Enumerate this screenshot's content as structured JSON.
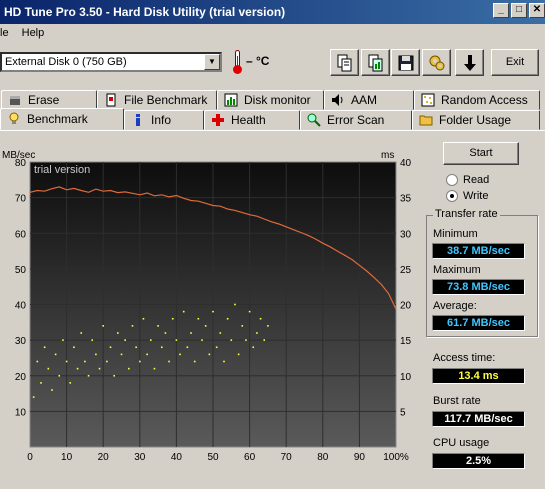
{
  "window": {
    "title": "HD Tune Pro 3.50 - Hard Disk Utility (trial version)"
  },
  "menu": {
    "file": "le",
    "help": "Help"
  },
  "toolbar": {
    "disk": "External Disk 0 (750 GB)",
    "temperature": "– °C",
    "exit_label": "Exit"
  },
  "tabs_top": [
    {
      "label": "Erase"
    },
    {
      "label": "File Benchmark"
    },
    {
      "label": "Disk monitor"
    },
    {
      "label": "AAM"
    },
    {
      "label": "Random Access"
    }
  ],
  "tabs_bottom": [
    {
      "label": "Benchmark"
    },
    {
      "label": "Info"
    },
    {
      "label": "Health"
    },
    {
      "label": "Error Scan"
    },
    {
      "label": "Folder Usage"
    }
  ],
  "controls": {
    "start_label": "Start",
    "read_label": "Read",
    "write_label": "Write",
    "selected_mode": "Write"
  },
  "transfer": {
    "group_title": "Transfer rate",
    "minimum_label": "Minimum",
    "minimum_value": "38.7 MB/sec",
    "maximum_label": "Maximum",
    "maximum_value": "73.8 MB/sec",
    "average_label": "Average:",
    "average_value": "61.7 MB/sec"
  },
  "stats": {
    "access_label": "Access time:",
    "access_value": "13.4 ms",
    "burst_label": "Burst rate",
    "burst_value": "117.7 MB/sec",
    "cpu_label": "CPU usage",
    "cpu_value": "2.5%"
  },
  "colors": {
    "transfer_line": "#e06a3a",
    "access_points": "#ffff40",
    "value_blue": "#3fc6ff",
    "value_yellow": "#ffff40"
  },
  "chart_data": {
    "type": "line",
    "watermark": "trial version",
    "ylabel": "MB/sec",
    "y2label": "ms",
    "xlim": [
      0,
      100
    ],
    "ylim": [
      0,
      80
    ],
    "y2lim": [
      0,
      40
    ],
    "x_ticks": [
      "0",
      "10",
      "20",
      "30",
      "40",
      "50",
      "60",
      "70",
      "80",
      "90",
      "100%"
    ],
    "y_ticks": [
      "10",
      "20",
      "30",
      "40",
      "50",
      "60",
      "70",
      "80"
    ],
    "y2_ticks": [
      "5",
      "10",
      "15",
      "20",
      "25",
      "30",
      "35",
      "40"
    ],
    "grid": true,
    "series": [
      {
        "axis": "left",
        "x": [
          0,
          2,
          4,
          6,
          8,
          10,
          12,
          14,
          16,
          18,
          20,
          22,
          24,
          26,
          28,
          30,
          32,
          34,
          36,
          38,
          40,
          42,
          44,
          46,
          48,
          50,
          52,
          54,
          56,
          58,
          60,
          62,
          64,
          66,
          68,
          70,
          72,
          74,
          76,
          78,
          80,
          82,
          84,
          86,
          88,
          90,
          92,
          94,
          96,
          98,
          100
        ],
        "values": [
          71.5,
          72,
          71.8,
          72.5,
          73,
          72.2,
          72.6,
          72,
          71.5,
          72.4,
          71.8,
          72,
          71.4,
          71.6,
          71.2,
          70.8,
          71.3,
          70.5,
          70.8,
          70.2,
          70.6,
          69.8,
          69.2,
          69,
          68.4,
          67.8,
          67.6,
          66.8,
          66.4,
          65.8,
          65.2,
          64.8,
          64,
          63.2,
          62.6,
          61.8,
          61,
          60.2,
          59.4,
          58.4,
          57.2,
          56.2,
          55,
          53.8,
          52.6,
          51,
          49.4,
          47.6,
          45.6,
          43,
          38.7
        ]
      },
      {
        "axis": "right",
        "name": "",
        "type": "scatter",
        "x": [
          1,
          2,
          3,
          4,
          5,
          6,
          7,
          8,
          9,
          10,
          11,
          12,
          13,
          14,
          15,
          16,
          17,
          18,
          19,
          20,
          21,
          22,
          23,
          24,
          25,
          26,
          27,
          28,
          29,
          30,
          31,
          32,
          33,
          34,
          35,
          36,
          37,
          38,
          39,
          40,
          41,
          42,
          43,
          44,
          45,
          46,
          47,
          48,
          49,
          50,
          51,
          52,
          53,
          54,
          55,
          56,
          57,
          58,
          59,
          60,
          61,
          62,
          63,
          64,
          65
        ],
        "values": [
          7,
          12,
          9,
          14,
          11,
          8,
          13,
          10,
          15,
          12,
          9,
          14,
          11,
          16,
          12,
          10,
          15,
          13,
          11,
          17,
          12,
          14,
          10,
          16,
          13,
          15,
          11,
          17,
          14,
          12,
          18,
          13,
          15,
          11,
          17,
          14,
          16,
          12,
          18,
          15,
          13,
          19,
          14,
          16,
          12,
          18,
          15,
          17,
          13,
          19,
          14,
          16,
          12,
          18,
          15,
          20,
          13,
          17,
          15,
          19,
          14,
          16,
          18,
          15,
          17
        ]
      }
    ]
  }
}
